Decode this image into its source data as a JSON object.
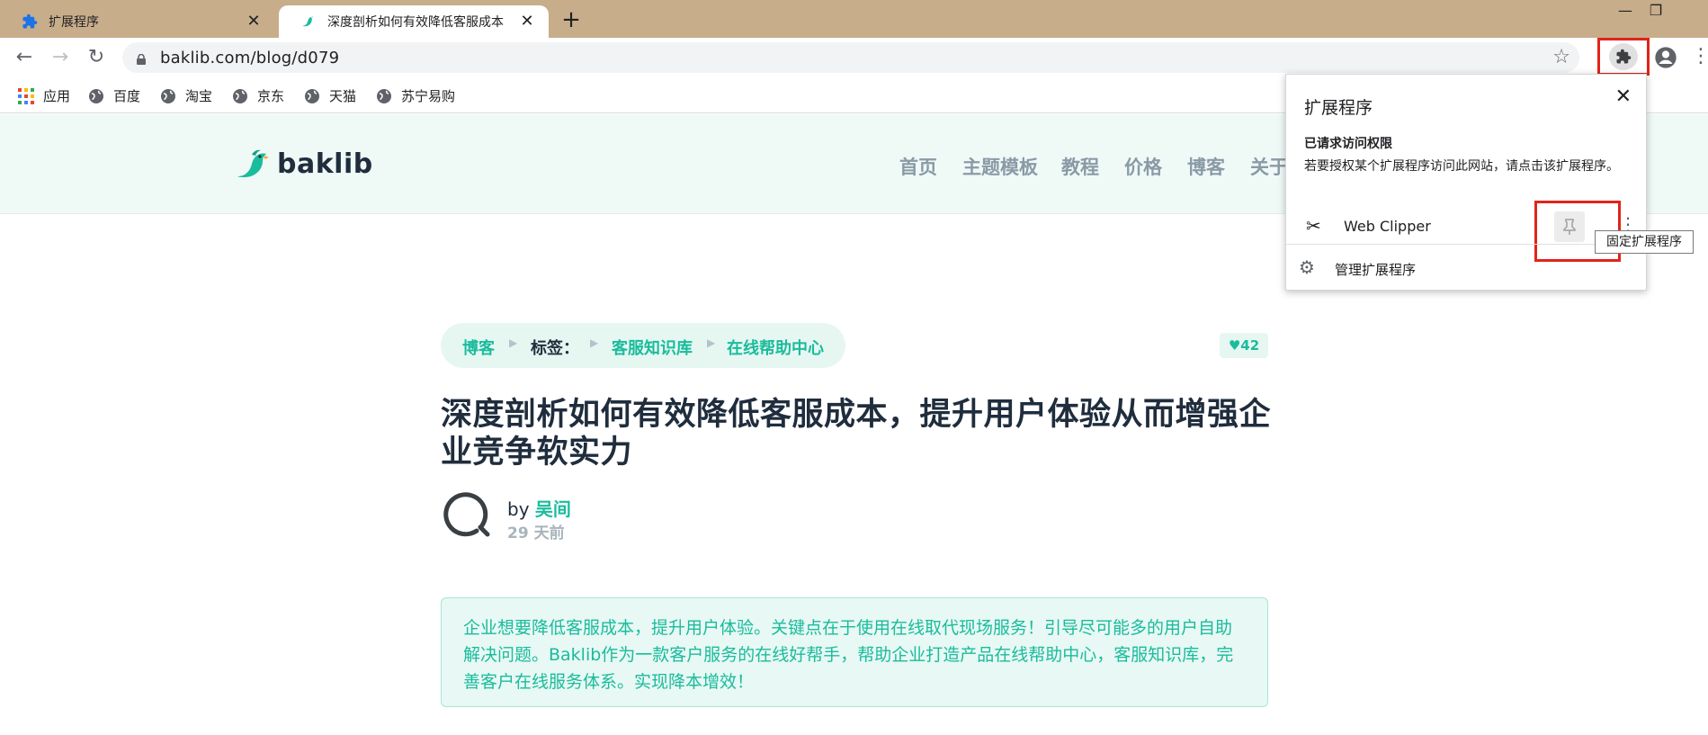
{
  "browser": {
    "tabs": [
      {
        "title": "扩展程序",
        "close": "✕"
      },
      {
        "title": "深度剖析如何有效降低客服成本",
        "close": "✕"
      }
    ],
    "new_tab": "+",
    "window_controls": {
      "minimize": "—",
      "maximize": "❐"
    },
    "url": "baklib.com/blog/d079",
    "bookmarks": [
      "应用",
      "百度",
      "淘宝",
      "京东",
      "天猫",
      "苏宁易购"
    ]
  },
  "site": {
    "logo_text": "baklib",
    "nav": [
      "首页",
      "主题模板",
      "教程",
      "价格",
      "博客",
      "关于"
    ]
  },
  "article": {
    "breadcrumb": [
      "博客",
      "标签：",
      "客服知识库",
      "在线帮助中心"
    ],
    "likes": "♥42",
    "title": "深度剖析如何有效降低客服成本，提升用户体验从而增强企业竞争软实力",
    "by": "by",
    "author": "吴间",
    "date": "29 天前",
    "summary": "企业想要降低客服成本，提升用户体验。关键点在于使用在线取代现场服务！引导尽可能多的用户自助解决问题。Baklib作为一款客户服务的在线好帮手，帮助企业打造产品在线帮助中心，客服知识库，完善客户在线服务体系。实现降本增效！"
  },
  "extensions_popup": {
    "title": "扩展程序",
    "close": "✕",
    "section_title": "已请求访问权限",
    "section_desc": "若要授权某个扩展程序访问此网站，请点击该扩展程序。",
    "extension_name": "Web Clipper",
    "manage_label": "管理扩展程序",
    "tooltip": "固定扩展程序"
  },
  "colors": {
    "accent": "#1abc9c",
    "highlight": "#e2231a",
    "tabbar": "#c8ad8a"
  }
}
